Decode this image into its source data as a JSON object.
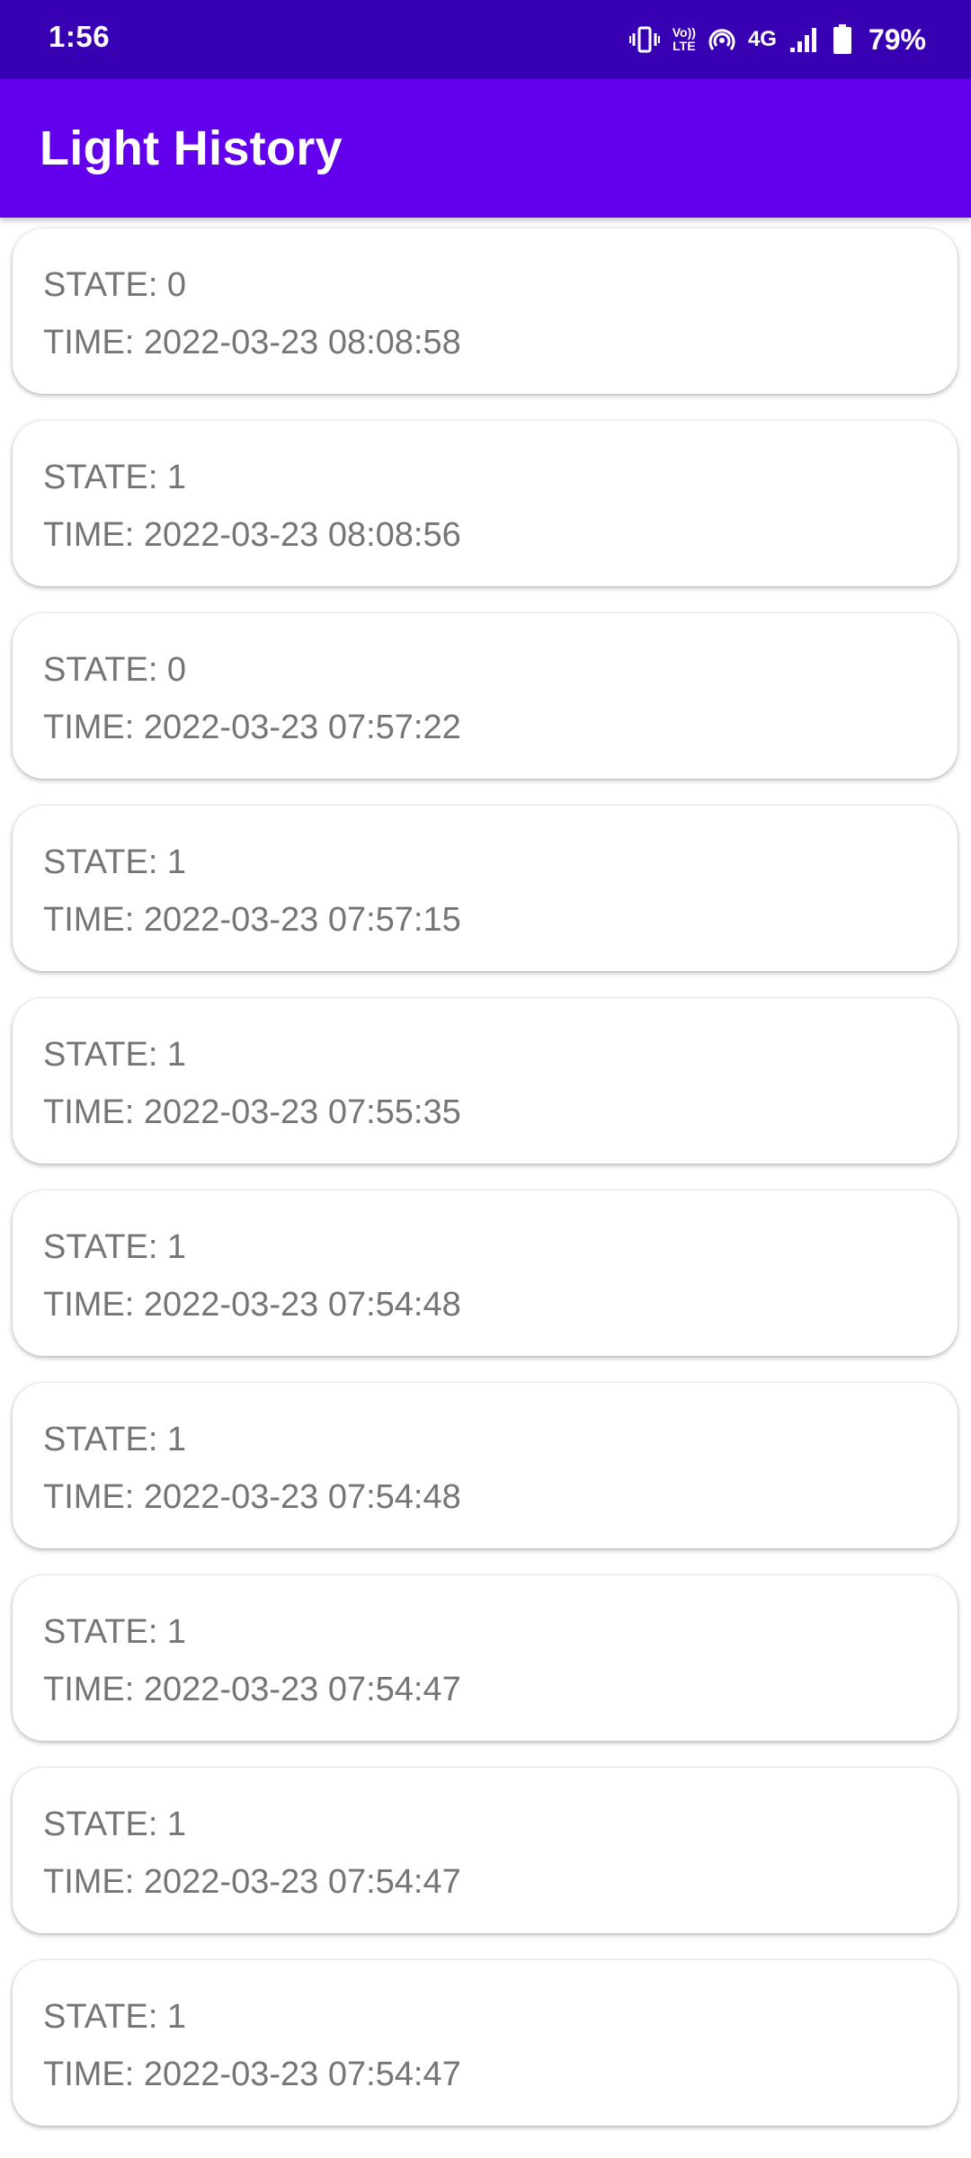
{
  "status_bar": {
    "time": "1:56",
    "network": "4G",
    "volte_top": "Vo))",
    "volte_bottom": "LTE",
    "battery": "79%",
    "icons": [
      "vibrate-icon",
      "volte-icon",
      "hotspot-icon",
      "signal-icon",
      "battery-icon"
    ]
  },
  "app_bar": {
    "title": "Light History"
  },
  "history": [
    {
      "state": "STATE: 0",
      "time": "TIME: 2022-03-23 08:08:58"
    },
    {
      "state": "STATE: 1",
      "time": "TIME: 2022-03-23 08:08:56"
    },
    {
      "state": "STATE: 0",
      "time": "TIME: 2022-03-23 07:57:22"
    },
    {
      "state": "STATE: 1",
      "time": "TIME: 2022-03-23 07:57:15"
    },
    {
      "state": "STATE: 1",
      "time": "TIME: 2022-03-23 07:55:35"
    },
    {
      "state": "STATE: 1",
      "time": "TIME: 2022-03-23 07:54:48"
    },
    {
      "state": "STATE: 1",
      "time": "TIME: 2022-03-23 07:54:48"
    },
    {
      "state": "STATE: 1",
      "time": "TIME: 2022-03-23 07:54:47"
    },
    {
      "state": "STATE: 1",
      "time": "TIME: 2022-03-23 07:54:47"
    },
    {
      "state": "STATE: 1",
      "time": "TIME: 2022-03-23 07:54:47"
    }
  ],
  "colors": {
    "status_bar": "#3700b3",
    "app_bar": "#6200ee",
    "card_text": "#757575",
    "card_bg": "#ffffff"
  }
}
